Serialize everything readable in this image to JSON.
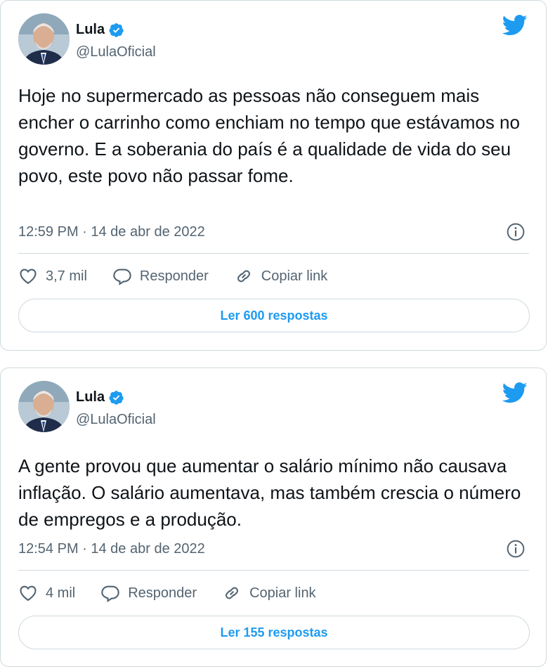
{
  "colors": {
    "accent": "#1d9bf0",
    "text": "#0f1419",
    "secondary": "#536471",
    "border": "#cfd9de"
  },
  "tweets": [
    {
      "author": {
        "name": "Lula",
        "handle": "@LulaOficial",
        "verified_icon": "verified-badge-icon"
      },
      "text": "Hoje no supermercado as pessoas não conseguem mais encher o carrinho como enchiam no tempo que estávamos no governo. E a soberania do país é a qualidade de vida do seu povo, este povo não passar fome.",
      "timestamp": "12:59 PM · 14 de abr de 2022",
      "likes": "3,7 mil",
      "reply_label": "Responder",
      "copy_label": "Copiar link",
      "replies_button": "Ler 600 respostas"
    },
    {
      "author": {
        "name": "Lula",
        "handle": "@LulaOficial",
        "verified_icon": "verified-badge-icon"
      },
      "text": "A gente provou que aumentar o salário mínimo não causava inflação. O salário aumentava, mas também crescia o número de empregos e a produção.",
      "timestamp": "12:54 PM · 14 de abr de 2022",
      "likes": "4 mil",
      "reply_label": "Responder",
      "copy_label": "Copiar link",
      "replies_button": "Ler 155 respostas"
    }
  ]
}
